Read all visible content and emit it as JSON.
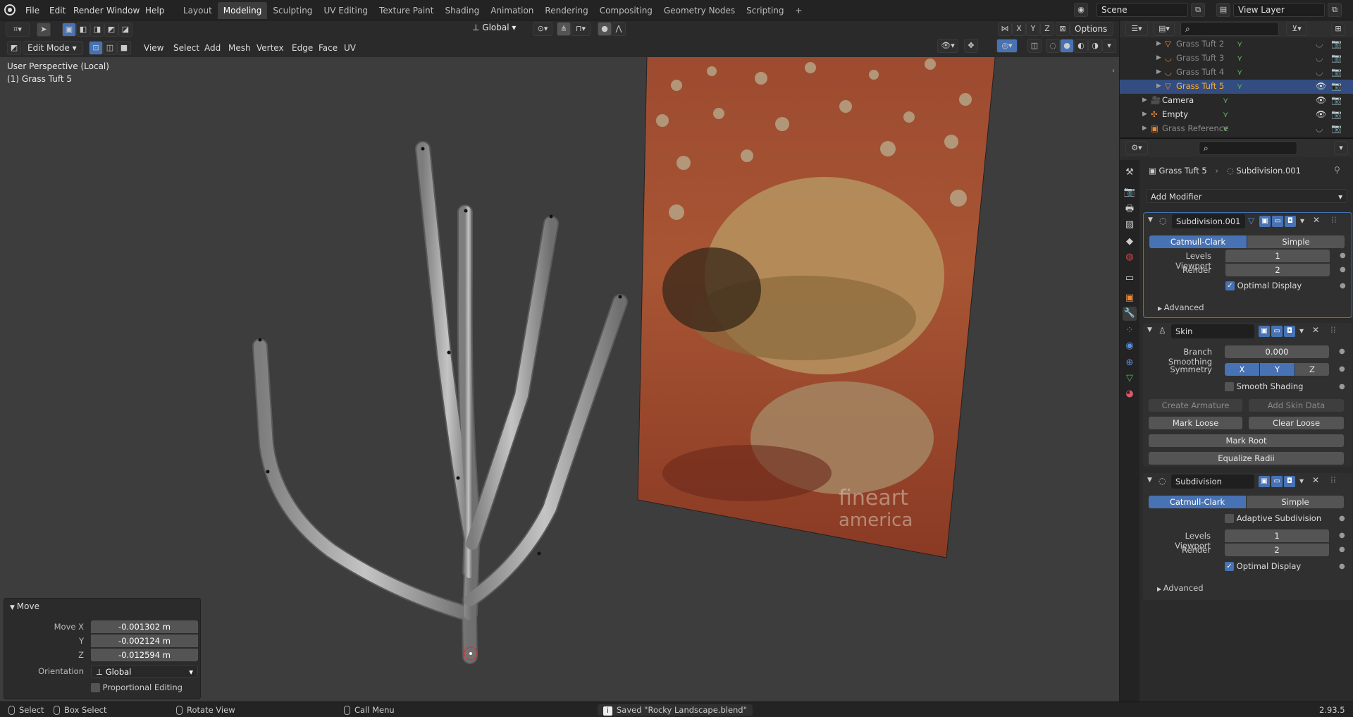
{
  "topbar": {
    "menus": [
      "File",
      "Edit",
      "Render",
      "Window",
      "Help"
    ],
    "workspaces": [
      {
        "label": "Layout",
        "active": false
      },
      {
        "label": "Modeling",
        "active": true
      },
      {
        "label": "Sculpting",
        "active": false
      },
      {
        "label": "UV Editing",
        "active": false
      },
      {
        "label": "Texture Paint",
        "active": false
      },
      {
        "label": "Shading",
        "active": false
      },
      {
        "label": "Animation",
        "active": false
      },
      {
        "label": "Rendering",
        "active": false
      },
      {
        "label": "Compositing",
        "active": false
      },
      {
        "label": "Geometry Nodes",
        "active": false
      },
      {
        "label": "Scripting",
        "active": false
      }
    ],
    "add_tab": "+",
    "scene": "Scene",
    "view_layer": "View Layer"
  },
  "viewport_header": {
    "mode": "Edit Mode",
    "menus": [
      "View",
      "Select",
      "Add",
      "Mesh",
      "Vertex",
      "Edge",
      "Face",
      "UV"
    ],
    "transform_orientation": "Global",
    "axis_x": "X",
    "axis_y": "Y",
    "axis_z": "Z",
    "options": "Options"
  },
  "viewport": {
    "perspective": "User Perspective (Local)",
    "object": "(1) Grass Tuft 5",
    "watermark_line1": "fineart",
    "watermark_line2": "america"
  },
  "redo_panel": {
    "title": "Move",
    "move_x_label": "Move X",
    "move_x": "-0.001302 m",
    "y_label": "Y",
    "y": "-0.002124 m",
    "z_label": "Z",
    "z": "-0.012594 m",
    "orientation_label": "Orientation",
    "orientation": "Global",
    "proportional": "Proportional Editing"
  },
  "outliner": {
    "rows": [
      {
        "label": "Grass Tuft 2",
        "selected": false,
        "dim": true
      },
      {
        "label": "Grass Tuft 3",
        "selected": false,
        "dim": true
      },
      {
        "label": "Grass Tuft 4",
        "selected": false,
        "dim": true
      },
      {
        "label": "Grass Tuft 5",
        "selected": true,
        "dim": false
      },
      {
        "label": "Camera",
        "selected": false,
        "dim": false
      },
      {
        "label": "Empty",
        "selected": false,
        "dim": false
      },
      {
        "label": "Grass Reference",
        "selected": false,
        "dim": true
      }
    ]
  },
  "properties": {
    "breadcrumb_object": "Grass Tuft 5",
    "breadcrumb_modifier": "Subdivision.001",
    "add_modifier": "Add Modifier",
    "subdiv1": {
      "name": "Subdivision.001",
      "catmull": "Catmull-Clark",
      "simple": "Simple",
      "levels_label": "Levels Viewport",
      "levels": "1",
      "render_label": "Render",
      "render": "2",
      "optimal": "Optimal Display",
      "advanced": "Advanced"
    },
    "skin": {
      "name": "Skin",
      "branch_label": "Branch Smoothing",
      "branch": "0.000",
      "symmetry_label": "Symmetry",
      "x": "X",
      "y": "Y",
      "z": "Z",
      "smooth": "Smooth Shading",
      "create_armature": "Create Armature",
      "add_skin_data": "Add Skin Data",
      "mark_loose": "Mark Loose",
      "clear_loose": "Clear Loose",
      "mark_root": "Mark Root",
      "equalize": "Equalize Radii"
    },
    "subdiv2": {
      "name": "Subdivision",
      "catmull": "Catmull-Clark",
      "simple": "Simple",
      "adaptive": "Adaptive Subdivision",
      "levels_label": "Levels Viewport",
      "levels": "1",
      "render_label": "Render",
      "render": "2",
      "optimal": "Optimal Display",
      "advanced": "Advanced"
    }
  },
  "statusbar": {
    "select": "Select",
    "box_select": "Box Select",
    "rotate": "Rotate View",
    "call_menu": "Call Menu",
    "message": "Saved \"Rocky Landscape.blend\"",
    "version": "2.93.5"
  }
}
